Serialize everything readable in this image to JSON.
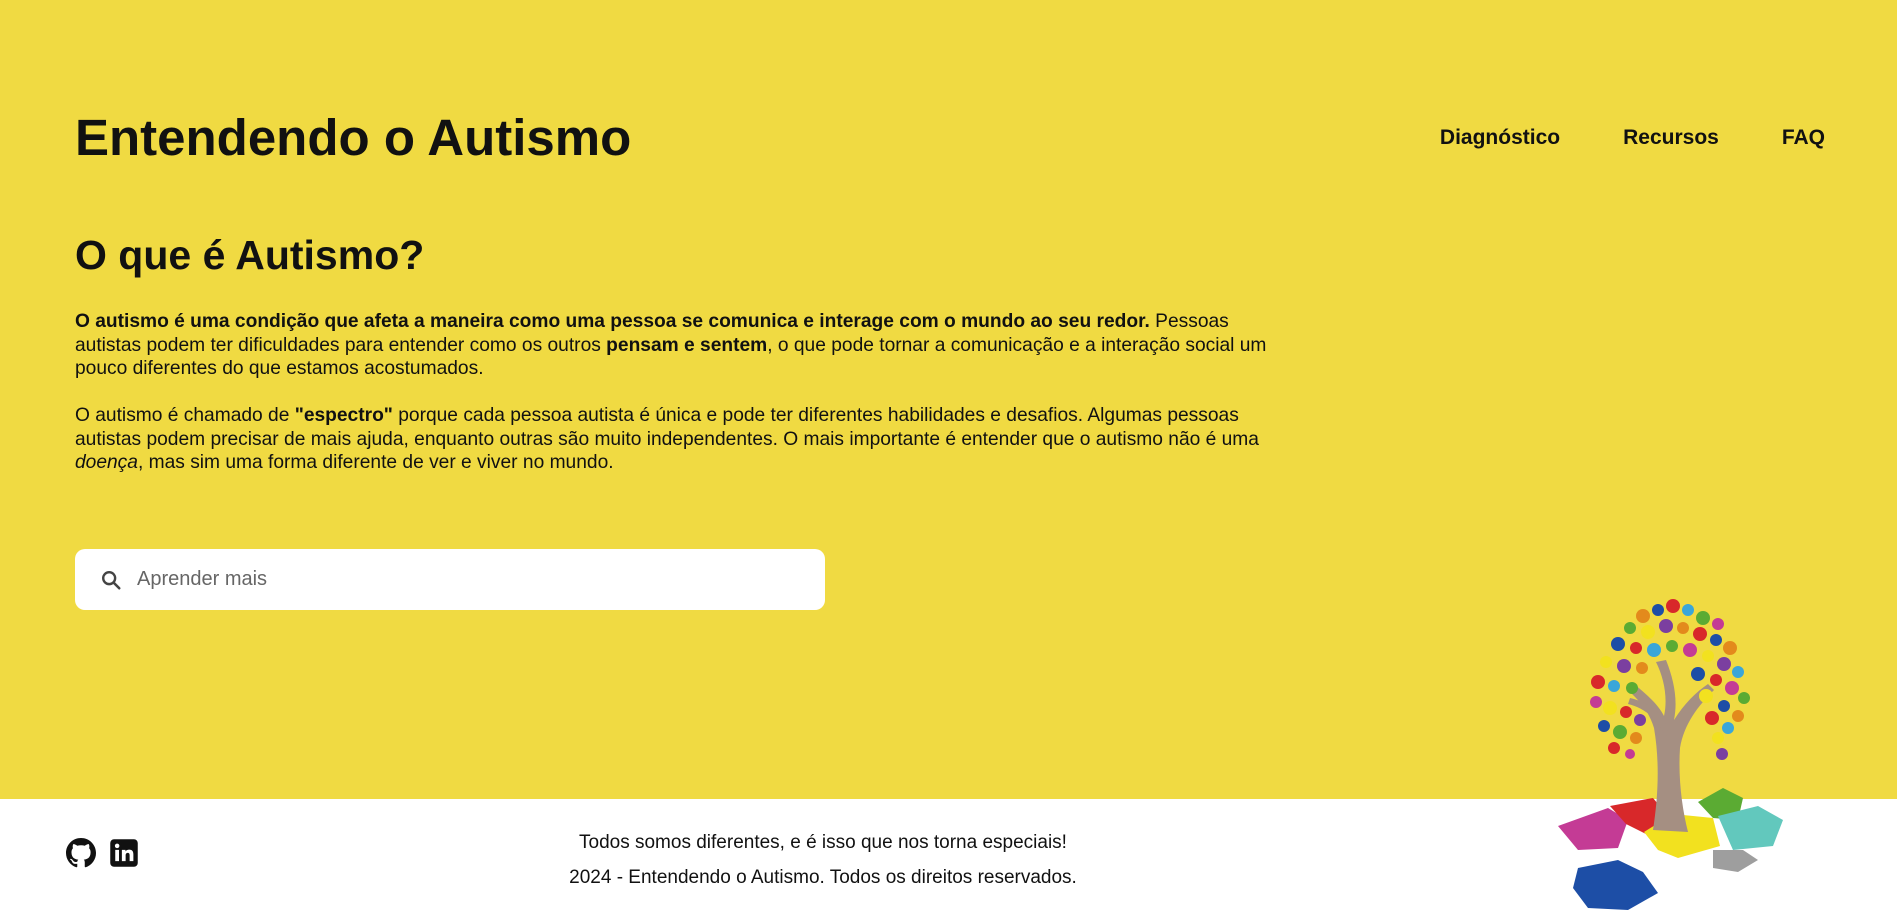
{
  "header": {
    "site_title": "Entendendo o Autismo",
    "nav": [
      "Diagnóstico",
      "Recursos",
      "FAQ"
    ]
  },
  "main": {
    "heading": "O que é Autismo?",
    "p1": {
      "bold_lead": "O autismo é uma condição que afeta a maneira como uma pessoa se comunica e interage com o mundo ao seu redor.",
      "text_a": " Pessoas autistas podem ter dificuldades para entender como os outros ",
      "bold_mid": "pensam e sentem",
      "text_b": ", o que pode tornar a comunicação e a interação social um pouco diferentes do que estamos acostumados."
    },
    "p2": {
      "text_a": "O autismo é chamado de ",
      "bold": "\"espectro\"",
      "text_b": " porque cada pessoa autista é única e pode ter diferentes habilidades e desafios. Algumas pessoas autistas podem precisar de mais ajuda, enquanto outras são muito independentes. O mais importante é entender que o autismo não é uma ",
      "italic": "doença",
      "text_c": ", mas sim uma forma diferente de ver e viver no mundo."
    }
  },
  "search": {
    "placeholder": "Aprender mais",
    "icon": "search-icon"
  },
  "footer": {
    "tagline": "Todos somos diferentes, e é isso que nos torna especiais!",
    "copyright": "2024 - Entendendo o Autismo. Todos os direitos reservados.",
    "social_icons": [
      "github-icon",
      "linkedin-icon"
    ]
  },
  "colors": {
    "background": "#f0da42",
    "footer_background": "#ffffff",
    "text": "#111111"
  },
  "illustration": "puzzle-tree-illustration"
}
